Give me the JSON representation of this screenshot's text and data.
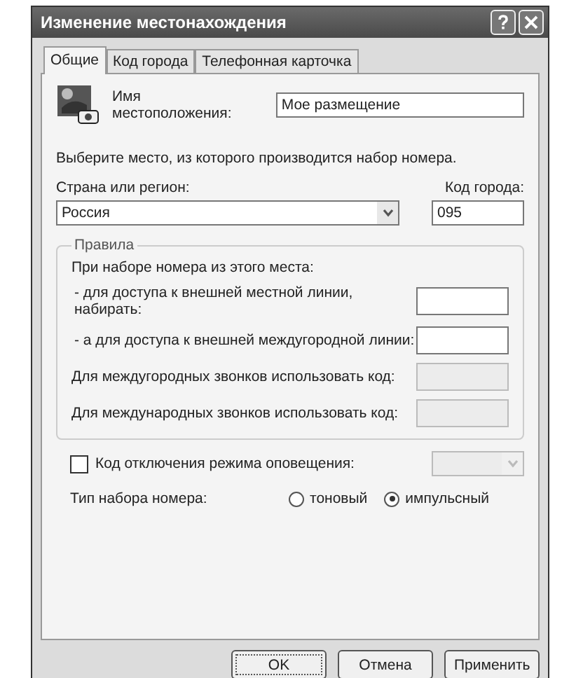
{
  "window": {
    "title": "Изменение местонахождения"
  },
  "tabs": [
    {
      "label": "Общие",
      "selected": true
    },
    {
      "label": "Код города",
      "selected": false
    },
    {
      "label": "Телефонная карточка",
      "selected": false
    }
  ],
  "location_name": {
    "label": "Имя местоположения:",
    "value": "Мое размещение"
  },
  "instruction": "Выберите место, из которого производится набор номера.",
  "country": {
    "label": "Страна или регион:",
    "value": "Россия"
  },
  "area_code": {
    "label": "Код города:",
    "value": "095"
  },
  "rules": {
    "title": "Правила",
    "intro": "При наборе номера из этого места:",
    "fields": [
      {
        "label": "- для доступа к внешней местной линии, набирать:",
        "disabled": false
      },
      {
        "label": "- а для доступа к внешней междугородной линии:",
        "disabled": false
      },
      {
        "label": "Для междугородных звонков использовать код:",
        "disabled": true
      },
      {
        "label": "Для международных звонков использовать код:",
        "disabled": true
      }
    ]
  },
  "call_waiting": {
    "label": "Код отключения режима оповещения:",
    "checked": false
  },
  "dial_type": {
    "label": "Тип набора номера:",
    "options": [
      {
        "label": "тоновый",
        "selected": false
      },
      {
        "label": "импульсный",
        "selected": true
      }
    ]
  },
  "buttons": [
    "OK",
    "Отмена",
    "Применить"
  ]
}
